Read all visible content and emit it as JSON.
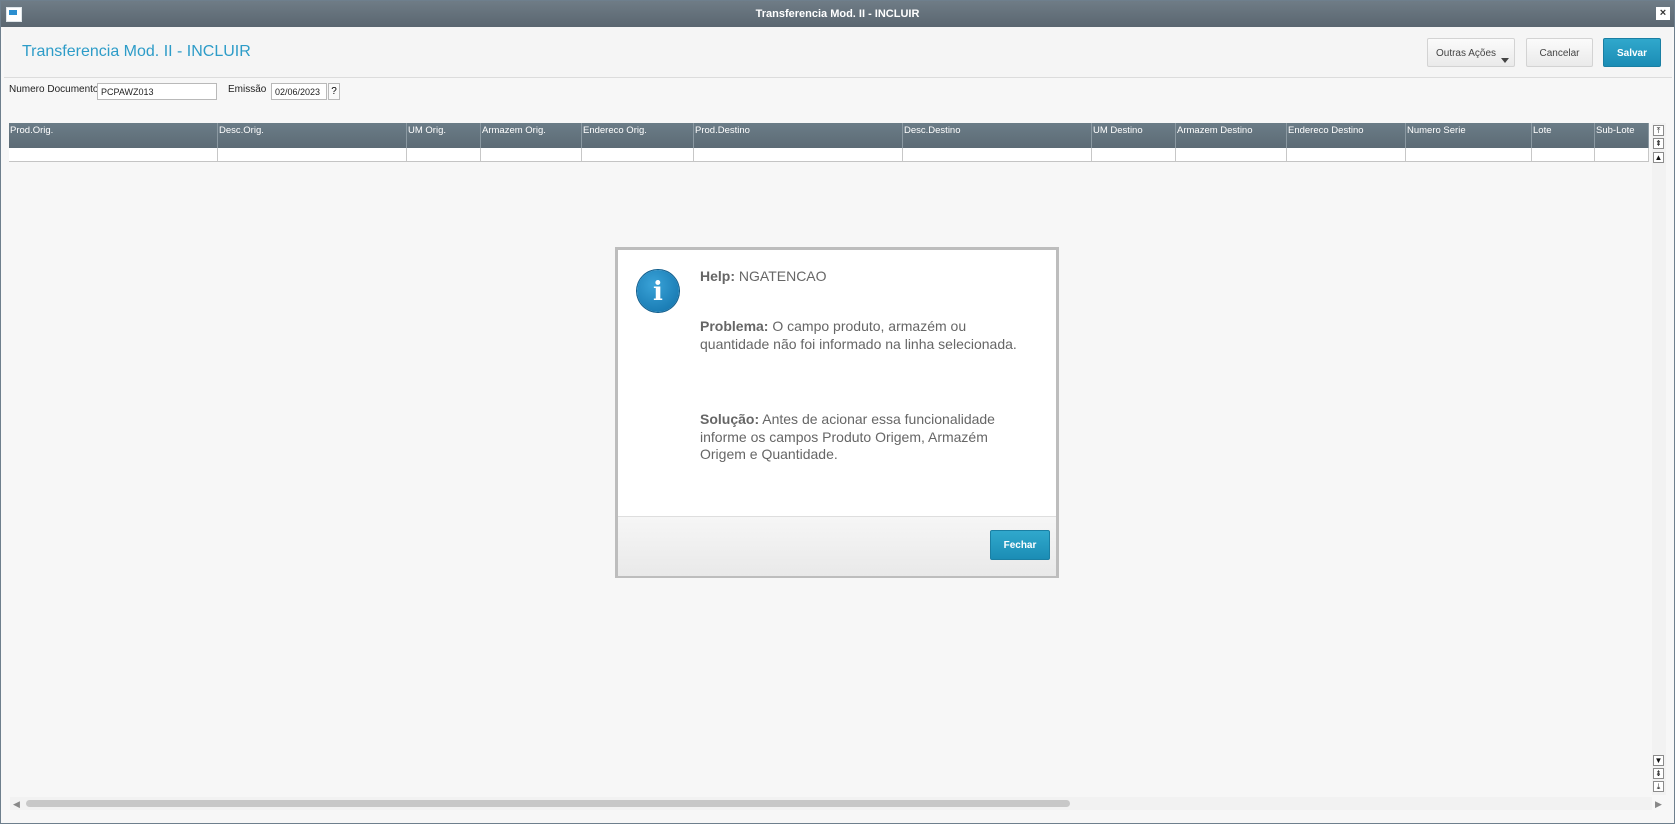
{
  "window": {
    "title": "Transferencia Mod. II - INCLUIR",
    "close_label": "×"
  },
  "header": {
    "title": "Transferencia Mod. II - INCLUIR",
    "outras_label": "Outras Ações",
    "cancelar_label": "Cancelar",
    "salvar_label": "Salvar",
    "accent_color": "#2d9cc8"
  },
  "form": {
    "numero_label": "Numero Documento",
    "numero_value": "PCPAWZ013",
    "emissao_label": "Emissão",
    "emissao_value": "02/06/2023",
    "help_button": "?"
  },
  "grid": {
    "columns": [
      {
        "label": "Prod.Orig."
      },
      {
        "label": "Desc.Orig."
      },
      {
        "label": "UM Orig."
      },
      {
        "label": "Armazem Orig."
      },
      {
        "label": "Endereco Orig."
      },
      {
        "label": "Prod.Destino"
      },
      {
        "label": "Desc.Destino"
      },
      {
        "label": "UM Destino"
      },
      {
        "label": "Armazem Destino"
      },
      {
        "label": "Endereco Destino"
      },
      {
        "label": "Numero Serie"
      },
      {
        "label": "Lote"
      },
      {
        "label": "Sub-Lote"
      }
    ],
    "rows": [
      [
        "",
        "",
        "",
        "",
        "",
        "",
        "",
        "",
        "",
        "",
        "",
        "",
        ""
      ]
    ]
  },
  "dialog": {
    "help_label": "Help:",
    "help_code": "NGATENCAO",
    "problem_label": "Problema:",
    "problem_text": "O campo produto, armazém ou quantidade não foi informado na linha selecionada.",
    "solution_label": "Solução:",
    "solution_text": "Antes de acionar essa funcionalidade informe os campos Produto Origem, Armazém Origem e Quantidade.",
    "icon": "info-icon",
    "close_label": "Fechar"
  }
}
